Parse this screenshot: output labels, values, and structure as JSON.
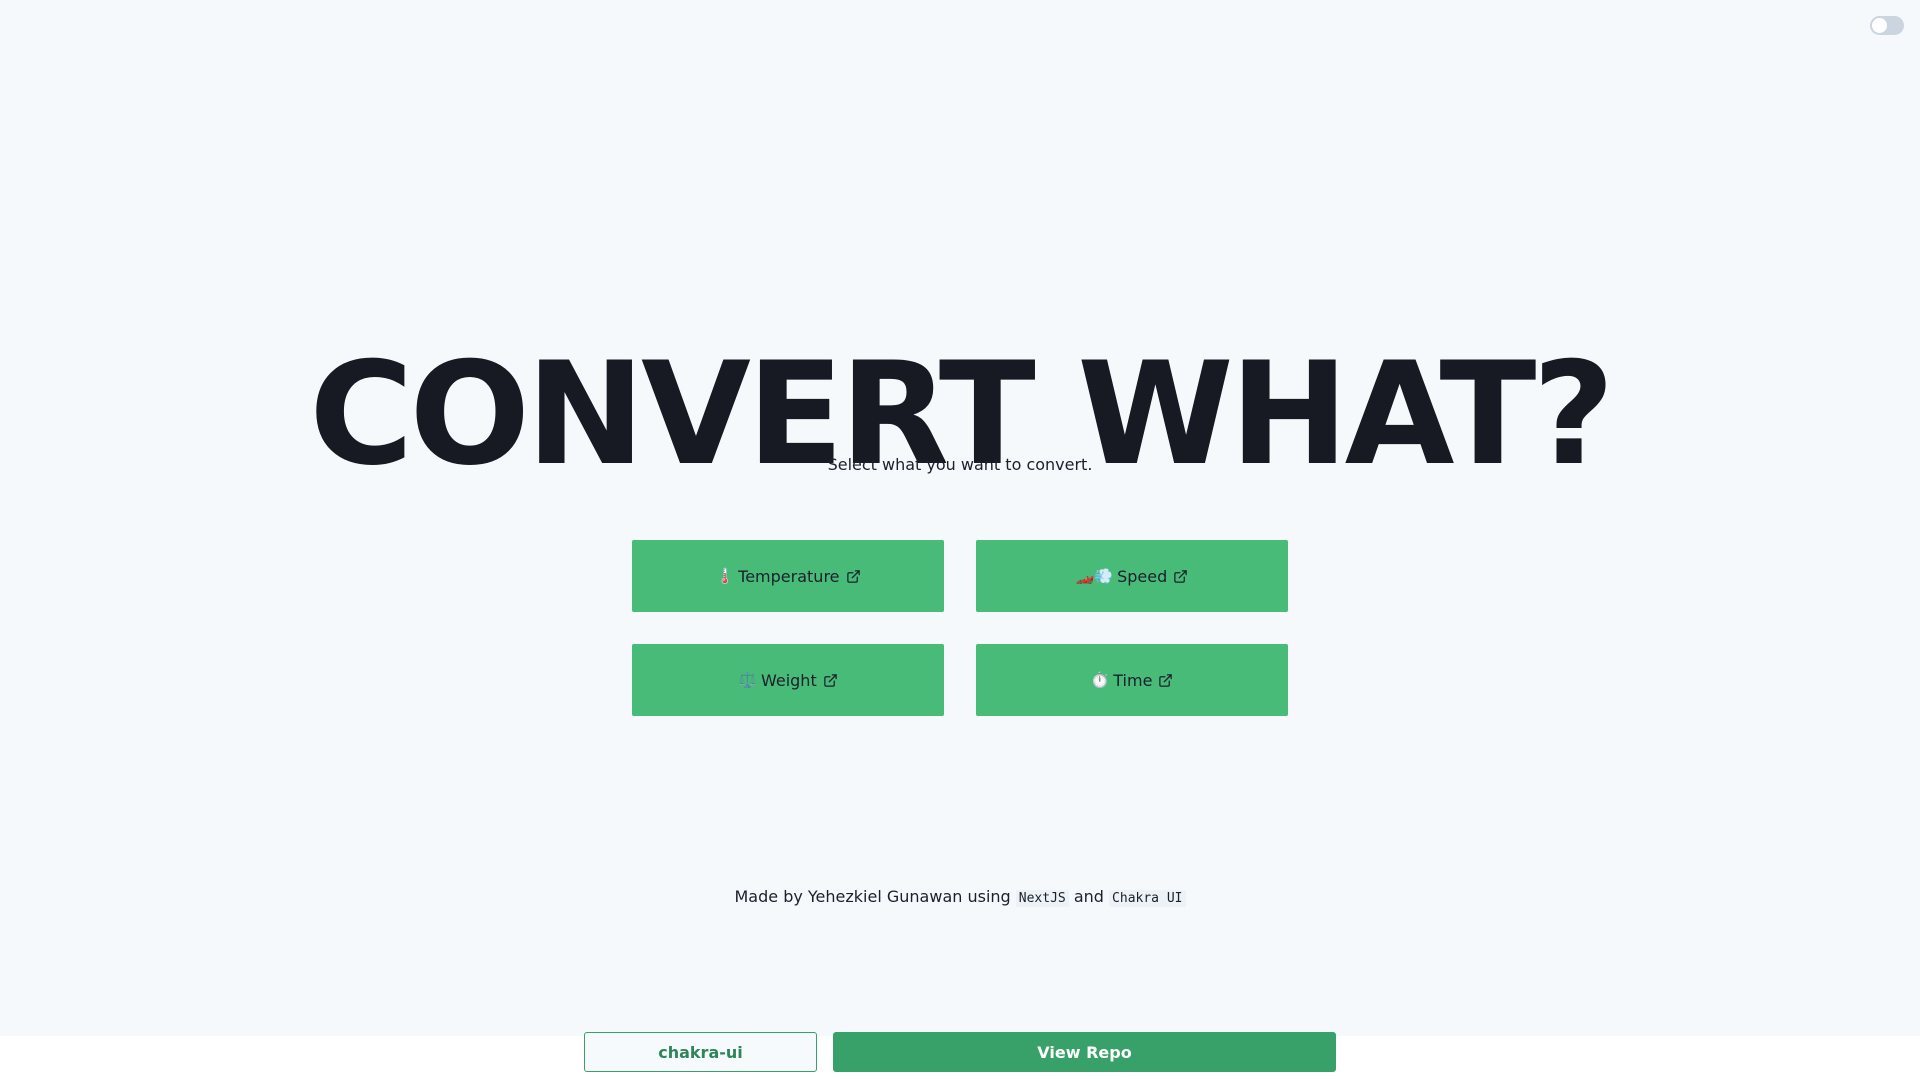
{
  "theme": {
    "background": "#f6f9fc",
    "accent": "#48bb78",
    "accent_dark": "#38a169",
    "title_color": "#171923"
  },
  "toggle": {
    "icon": "theme-toggle-switch",
    "state": "off"
  },
  "hero": {
    "title": "CONVERT WHAT?",
    "subtitle": "Select what you want to convert."
  },
  "converters": [
    {
      "emoji": "🌡️",
      "label": "Temperature",
      "icon": "external-link-icon"
    },
    {
      "emoji": "🏎️💨",
      "label": "Speed",
      "icon": "external-link-icon"
    },
    {
      "emoji": "⚖️",
      "label": "Weight",
      "icon": "external-link-icon"
    },
    {
      "emoji": "⏱️",
      "label": "Time",
      "icon": "external-link-icon"
    }
  ],
  "footer": {
    "prefix": "Made by Yehezkiel Gunawan using",
    "tech1": "NextJS",
    "joiner": "and",
    "tech2": "Chakra UI"
  },
  "bottom_bar": {
    "outline_button": "chakra-ui",
    "solid_button": "View Repo"
  }
}
